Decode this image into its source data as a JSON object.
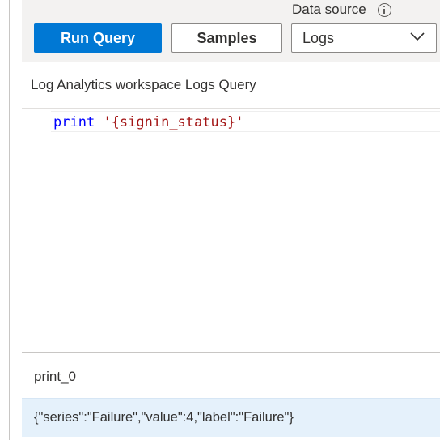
{
  "toolbar": {
    "data_source_label": "Data source",
    "run_query_label": "Run Query",
    "samples_label": "Samples",
    "data_source_value": "Logs"
  },
  "query": {
    "title": "Log Analytics workspace Logs Query",
    "code_keyword": "print",
    "code_string": "'{signin_status}'"
  },
  "results": {
    "columns": [
      "print_0"
    ],
    "rows": [
      [
        "{\"series\":\"Failure\",\"value\":4,\"label\":\"Failure\"}"
      ]
    ]
  },
  "colors": {
    "accent": "#0078d4",
    "toolbar_bg": "#f3f2f1",
    "selected_row_bg": "#e5f1fb",
    "keyword": "#0000ff",
    "string": "#a31515"
  },
  "icons": {
    "info": "info-icon",
    "dropdown": "chevron-down-icon"
  }
}
